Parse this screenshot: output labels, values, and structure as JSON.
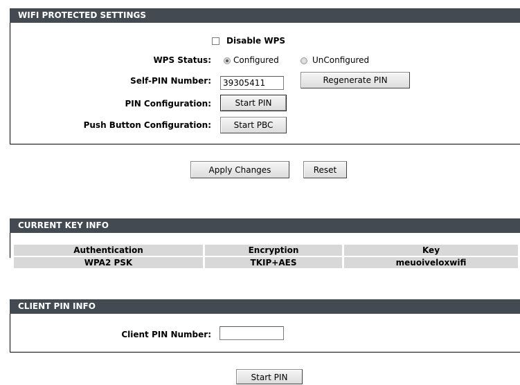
{
  "wps": {
    "header": "WIFI PROTECTED SETTINGS",
    "disable_wps_label": "Disable WPS",
    "status_label": "WPS Status:",
    "status_options": [
      "Configured",
      "UnConfigured"
    ],
    "status_selected": "Configured",
    "self_pin_label": "Self-PIN Number:",
    "self_pin_value": "39305411",
    "regenerate_label": "Regenerate PIN",
    "pin_config_label": "PIN Configuration:",
    "start_pin_label": "Start PIN",
    "pbc_label": "Push Button Configuration:",
    "start_pbc_label": "Start PBC"
  },
  "actions": {
    "apply_label": "Apply Changes",
    "reset_label": "Reset"
  },
  "key_info": {
    "header": "CURRENT KEY INFO",
    "columns": [
      "Authentication",
      "Encryption",
      "Key"
    ],
    "row": [
      "WPA2 PSK",
      "TKIP+AES",
      "meuoiveloxwifi"
    ]
  },
  "client_pin": {
    "header": "CLIENT PIN INFO",
    "label": "Client PIN Number:",
    "value": "",
    "start_label": "Start PIN"
  }
}
